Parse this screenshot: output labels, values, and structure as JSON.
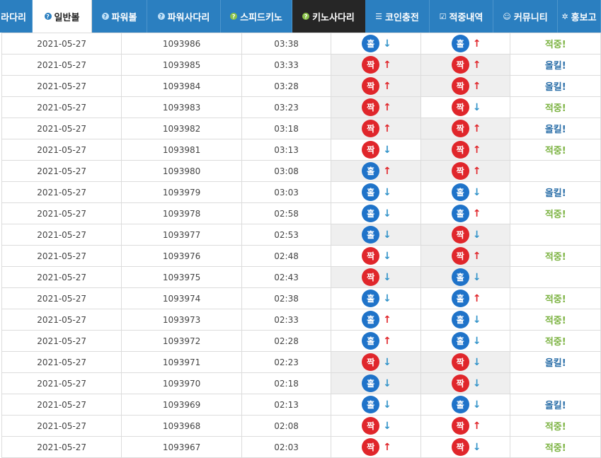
{
  "nav": {
    "tabs": [
      {
        "label": "라다리",
        "icon": "none-icon",
        "state": "normal"
      },
      {
        "label": "일반볼",
        "icon": "question-circle-icon",
        "state": "active"
      },
      {
        "label": "파워볼",
        "icon": "question-circle-icon",
        "state": "normal"
      },
      {
        "label": "파워사다리",
        "icon": "question-circle-icon",
        "state": "normal"
      },
      {
        "label": "스피드키노",
        "icon": "question-circle-icon",
        "state": "normal"
      },
      {
        "label": "키노사다리",
        "icon": "question-circle-icon",
        "state": "dark"
      },
      {
        "label": "코인충전",
        "icon": "coin-stack-icon",
        "state": "normal"
      },
      {
        "label": "적중내역",
        "icon": "checkbox-icon",
        "state": "normal"
      },
      {
        "label": "커뮤니티",
        "icon": "smile-icon",
        "state": "normal"
      },
      {
        "label": "홍보고",
        "icon": "gear-icon",
        "state": "normal"
      }
    ]
  },
  "labels": {
    "odd": "홀",
    "even": "짝",
    "hit": "적중!",
    "allkill": "올킬!"
  },
  "colors": {
    "nav": "#2b7fc0",
    "odd": "#1f73c9",
    "even": "#e0262b",
    "hit": "#7cb342",
    "allkill": "#2a6ea8"
  },
  "rows": [
    {
      "date": "2021-05-27",
      "round": "1093986",
      "time": "03:38",
      "a": "odd",
      "a_dir": "down",
      "a_hi": false,
      "b": "odd",
      "b_dir": "up",
      "b_hi": false,
      "status": "hit"
    },
    {
      "date": "2021-05-27",
      "round": "1093985",
      "time": "03:33",
      "a": "even",
      "a_dir": "up",
      "a_hi": true,
      "b": "even",
      "b_dir": "up",
      "b_hi": true,
      "status": "allkill"
    },
    {
      "date": "2021-05-27",
      "round": "1093984",
      "time": "03:28",
      "a": "even",
      "a_dir": "up",
      "a_hi": true,
      "b": "even",
      "b_dir": "up",
      "b_hi": true,
      "status": "allkill"
    },
    {
      "date": "2021-05-27",
      "round": "1093983",
      "time": "03:23",
      "a": "even",
      "a_dir": "up",
      "a_hi": true,
      "b": "even",
      "b_dir": "down",
      "b_hi": false,
      "status": "hit"
    },
    {
      "date": "2021-05-27",
      "round": "1093982",
      "time": "03:18",
      "a": "even",
      "a_dir": "up",
      "a_hi": true,
      "b": "even",
      "b_dir": "up",
      "b_hi": true,
      "status": "allkill"
    },
    {
      "date": "2021-05-27",
      "round": "1093981",
      "time": "03:13",
      "a": "even",
      "a_dir": "down",
      "a_hi": false,
      "b": "even",
      "b_dir": "up",
      "b_hi": true,
      "status": "hit"
    },
    {
      "date": "2021-05-27",
      "round": "1093980",
      "time": "03:08",
      "a": "odd",
      "a_dir": "up",
      "a_hi": true,
      "b": "even",
      "b_dir": "up",
      "b_hi": true,
      "status": ""
    },
    {
      "date": "2021-05-27",
      "round": "1093979",
      "time": "03:03",
      "a": "odd",
      "a_dir": "down",
      "a_hi": false,
      "b": "odd",
      "b_dir": "down",
      "b_hi": false,
      "status": "allkill"
    },
    {
      "date": "2021-05-27",
      "round": "1093978",
      "time": "02:58",
      "a": "odd",
      "a_dir": "down",
      "a_hi": false,
      "b": "odd",
      "b_dir": "up",
      "b_hi": false,
      "status": "hit"
    },
    {
      "date": "2021-05-27",
      "round": "1093977",
      "time": "02:53",
      "a": "odd",
      "a_dir": "down",
      "a_hi": true,
      "b": "even",
      "b_dir": "down",
      "b_hi": true,
      "status": ""
    },
    {
      "date": "2021-05-27",
      "round": "1093976",
      "time": "02:48",
      "a": "even",
      "a_dir": "down",
      "a_hi": false,
      "b": "even",
      "b_dir": "up",
      "b_hi": true,
      "status": "hit"
    },
    {
      "date": "2021-05-27",
      "round": "1093975",
      "time": "02:43",
      "a": "even",
      "a_dir": "down",
      "a_hi": true,
      "b": "odd",
      "b_dir": "down",
      "b_hi": true,
      "status": ""
    },
    {
      "date": "2021-05-27",
      "round": "1093974",
      "time": "02:38",
      "a": "odd",
      "a_dir": "down",
      "a_hi": false,
      "b": "odd",
      "b_dir": "up",
      "b_hi": false,
      "status": "hit"
    },
    {
      "date": "2021-05-27",
      "round": "1093973",
      "time": "02:33",
      "a": "odd",
      "a_dir": "up",
      "a_hi": false,
      "b": "odd",
      "b_dir": "down",
      "b_hi": false,
      "status": "hit"
    },
    {
      "date": "2021-05-27",
      "round": "1093972",
      "time": "02:28",
      "a": "odd",
      "a_dir": "up",
      "a_hi": false,
      "b": "odd",
      "b_dir": "down",
      "b_hi": false,
      "status": "hit"
    },
    {
      "date": "2021-05-27",
      "round": "1093971",
      "time": "02:23",
      "a": "even",
      "a_dir": "down",
      "a_hi": true,
      "b": "even",
      "b_dir": "down",
      "b_hi": true,
      "status": "allkill"
    },
    {
      "date": "2021-05-27",
      "round": "1093970",
      "time": "02:18",
      "a": "odd",
      "a_dir": "down",
      "a_hi": true,
      "b": "even",
      "b_dir": "down",
      "b_hi": true,
      "status": ""
    },
    {
      "date": "2021-05-27",
      "round": "1093969",
      "time": "02:13",
      "a": "odd",
      "a_dir": "down",
      "a_hi": false,
      "b": "odd",
      "b_dir": "down",
      "b_hi": false,
      "status": "allkill"
    },
    {
      "date": "2021-05-27",
      "round": "1093968",
      "time": "02:08",
      "a": "even",
      "a_dir": "down",
      "a_hi": false,
      "b": "even",
      "b_dir": "up",
      "b_hi": false,
      "status": "hit"
    },
    {
      "date": "2021-05-27",
      "round": "1093967",
      "time": "02:03",
      "a": "even",
      "a_dir": "up",
      "a_hi": false,
      "b": "even",
      "b_dir": "down",
      "b_hi": false,
      "status": "hit"
    }
  ]
}
